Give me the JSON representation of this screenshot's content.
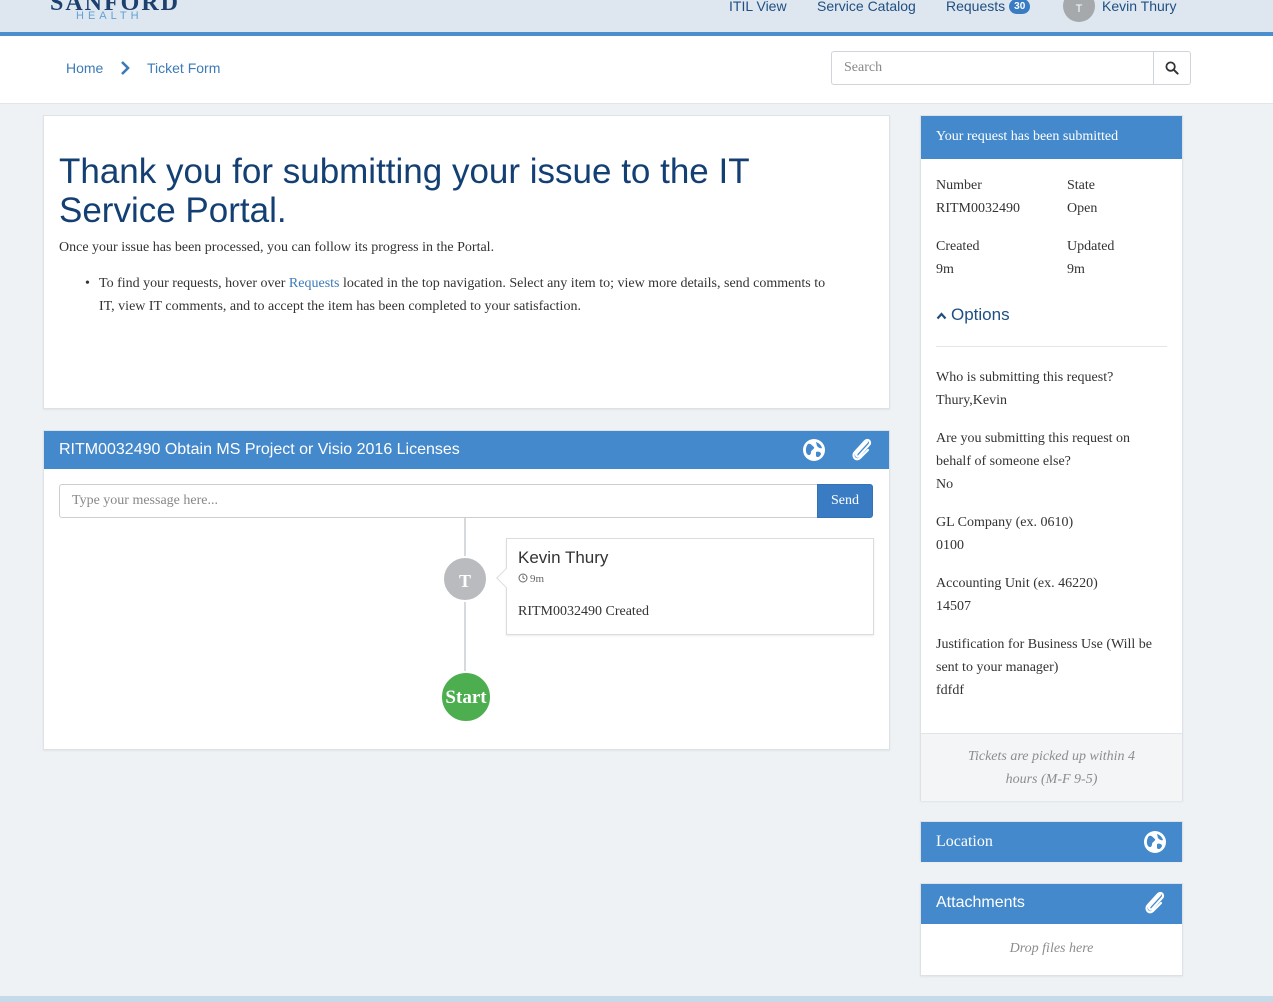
{
  "brand": {
    "name": "SANFORD",
    "sub": "HEALTH"
  },
  "nav": {
    "itil_view": "ITIL View",
    "service_catalog": "Service Catalog",
    "requests_label": "Requests",
    "requests_count": "30",
    "user_initial": "T",
    "user_name": "Kevin Thury"
  },
  "breadcrumb": {
    "home": "Home",
    "current": "Ticket Form"
  },
  "search": {
    "placeholder": "Search"
  },
  "thanks": {
    "title": "Thank you for submitting your issue to the IT Service Portal.",
    "paragraph": "Once your issue has been processed, you can follow its progress in the Portal.",
    "bullet_pre": "To find your requests, hover over ",
    "bullet_link": "Requests",
    "bullet_post": " located in the top navigation. Select any item to; view more details, send comments to IT, view IT comments, and to accept the item has been completed to your satisfaction."
  },
  "ritm": {
    "title": "RITM0032490 Obtain MS Project or Visio 2016 Licenses",
    "message_placeholder": "Type your message here...",
    "send_label": "Send",
    "entry": {
      "avatar_initial": "T",
      "author": "Kevin Thury",
      "time": "9m",
      "text": "RITM0032490 Created"
    },
    "start_label": "Start"
  },
  "summary": {
    "header": "Your request has been submitted",
    "number_label": "Number",
    "number_value": "RITM0032490",
    "state_label": "State",
    "state_value": "Open",
    "created_label": "Created",
    "created_value": "9m",
    "updated_label": "Updated",
    "updated_value": "9m",
    "options_label": "Options",
    "questions": [
      {
        "q": "Who is submitting this request?",
        "a": "Thury,Kevin"
      },
      {
        "q": "Are you submitting this request on behalf of someone else?",
        "a": "No"
      },
      {
        "q": "GL Company (ex. 0610)",
        "a": "0100"
      },
      {
        "q": "Accounting Unit (ex. 46220)",
        "a": "14507"
      },
      {
        "q": "Justification for Business Use (Will be sent to your manager)",
        "a": "fdfdf"
      }
    ],
    "footer": "Tickets are picked up within 4 hours (M-F 9-5)"
  },
  "location": {
    "header": "Location"
  },
  "attachments": {
    "header": "Attachments",
    "drop_text": "Drop files here"
  },
  "colors": {
    "primary": "#4389cc",
    "title": "#133f73",
    "start": "#4dae4f",
    "link": "#3c7ab8"
  }
}
